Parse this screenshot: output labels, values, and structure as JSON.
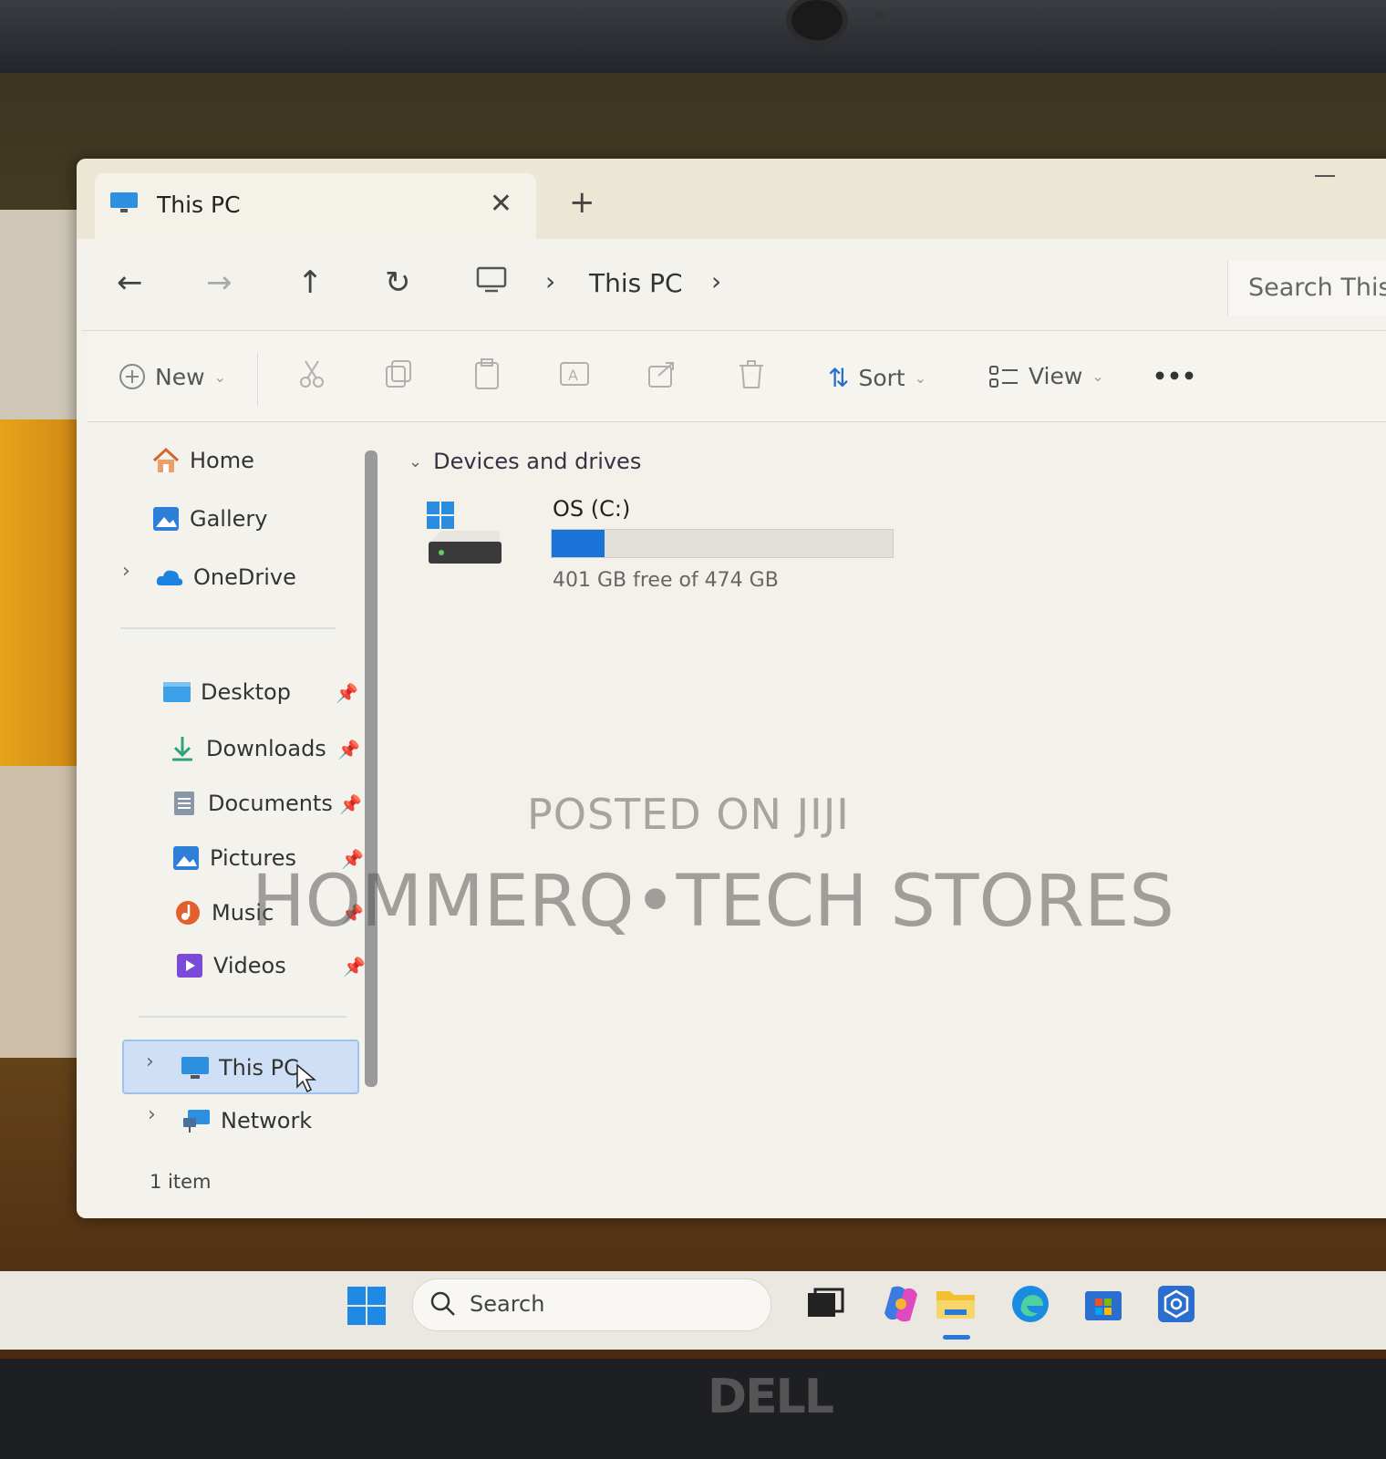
{
  "window": {
    "tab_title": "This PC",
    "tab_close": "✕",
    "new_tab": "+"
  },
  "navbar": {
    "back": "←",
    "forward": "→",
    "up": "↑",
    "refresh": "↻",
    "breadcrumb": "This PC",
    "sep": "›",
    "search_placeholder": "Search This PC"
  },
  "toolbar": {
    "new_label": "New",
    "sort_label": "Sort",
    "view_label": "View",
    "more_label": "•••"
  },
  "sidebar": {
    "home": "Home",
    "gallery": "Gallery",
    "onedrive": "OneDrive",
    "desktop": "Desktop",
    "downloads": "Downloads",
    "documents": "Documents",
    "pictures": "Pictures",
    "music": "Music",
    "videos": "Videos",
    "this_pc": "This PC",
    "network": "Network",
    "chevron": "›",
    "pin": "📌"
  },
  "status": {
    "count": "1 item"
  },
  "content": {
    "section": "Devices and drives",
    "drives": [
      {
        "name": "OS (C:)",
        "free_text": "401 GB free of 474 GB",
        "used_fraction": 0.154
      }
    ]
  },
  "watermark": {
    "line1": "POSTED ON JIJI",
    "line2": "HOMMERQ•TECH STORES"
  },
  "taskbar": {
    "search_label": "Search"
  },
  "device": {
    "brand": "DELL"
  },
  "colors": {
    "accent": "#1a74d8",
    "selection": "#cfe0f6"
  }
}
